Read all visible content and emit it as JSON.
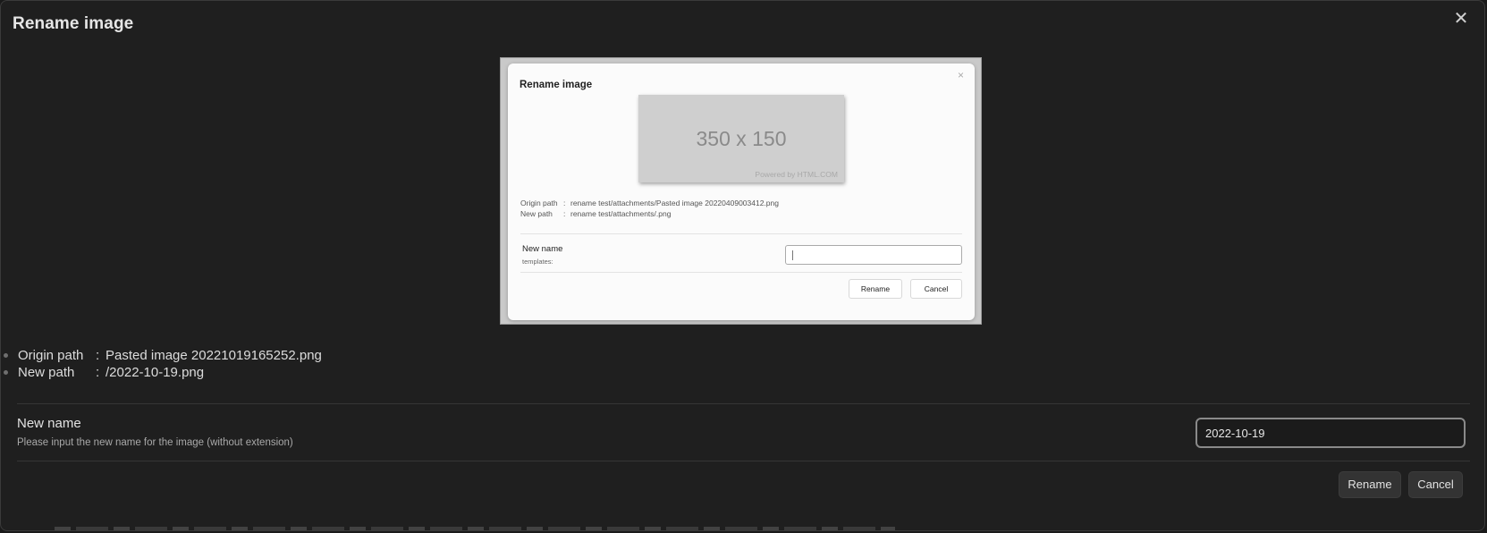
{
  "modal": {
    "title": "Rename image",
    "close_icon": "close-icon"
  },
  "preview": {
    "title": "Rename image",
    "close_glyph": "×",
    "image_size_text": "350 x 150",
    "image_powered_text": "Powered by HTML.COM",
    "origin_label": "Origin path",
    "origin_value": "rename test/attachments/Pasted image 20220409003412.png",
    "new_label": "New path",
    "new_value": "rename test/attachments/.png",
    "colon": ":",
    "new_name_label": "New name",
    "templates_label": "templates:",
    "rename_label": "Rename",
    "cancel_label": "Cancel"
  },
  "info": {
    "origin_label": "Origin path",
    "origin_value": "Pasted image 20221019165252.png",
    "new_label": "New path",
    "new_value": "/2022-10-19.png",
    "colon": ":"
  },
  "setting": {
    "name": "New name",
    "description": "Please input the new name for the image (without extension)",
    "input_value": "2022-10-19"
  },
  "buttons": {
    "rename": "Rename",
    "cancel": "Cancel"
  }
}
